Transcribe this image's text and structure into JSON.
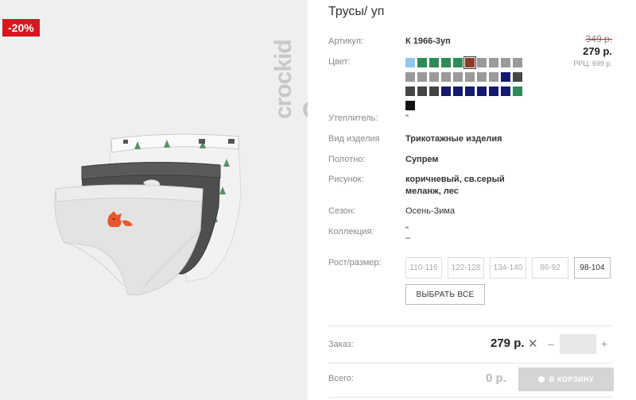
{
  "product": {
    "title": "Трусы/ уп",
    "discount_badge": "-20%",
    "brand_text": "crockid"
  },
  "price": {
    "old": "349 р.",
    "current": "279 р.",
    "rrp": "РРЦ: 699 р."
  },
  "attributes": {
    "article_label": "Артикул:",
    "article_value": "К 1966-3уп",
    "color_label": "Цвет:",
    "insulation_label": "Утеплитель:",
    "insulation_value": "\"",
    "kind_label": "Вид изделия",
    "kind_value": "Трикотажные изделия",
    "fabric_label": "Полотно:",
    "fabric_value": "Супрем",
    "pattern_label": "Рисунок:",
    "pattern_value_line1": "коричневый, св.серый",
    "pattern_value_line2": "меланж, лес",
    "season_label": "Сезон:",
    "season_value": "Осень-Зима",
    "collection_label": "Коллекция:",
    "collection_value_line1": "\"",
    "collection_value_line2": "–"
  },
  "swatches": [
    {
      "color": "#8ec7ef",
      "selected": false
    },
    {
      "color": "#2e8b57",
      "selected": false
    },
    {
      "color": "#2e8b57",
      "selected": false
    },
    {
      "color": "#2e8b57",
      "selected": false
    },
    {
      "color": "#2e8b57",
      "selected": false
    },
    {
      "color": "#8b3a2b",
      "selected": true
    },
    {
      "color": "#9a9a9a",
      "selected": false
    },
    {
      "color": "#9a9a9a",
      "selected": false
    },
    {
      "color": "#9a9a9a",
      "selected": false
    },
    {
      "color": "#9a9a9a",
      "selected": false
    },
    {
      "color": "#9a9a9a",
      "selected": false
    },
    {
      "color": "#9a9a9a",
      "selected": false
    },
    {
      "color": "#9a9a9a",
      "selected": false
    },
    {
      "color": "#9a9a9a",
      "selected": false
    },
    {
      "color": "#9a9a9a",
      "selected": false
    },
    {
      "color": "#9a9a9a",
      "selected": false
    },
    {
      "color": "#9a9a9a",
      "selected": false
    },
    {
      "color": "#9a9a9a",
      "selected": false
    },
    {
      "color": "#141a6e",
      "selected": false
    },
    {
      "color": "#444444",
      "selected": false
    },
    {
      "color": "#444444",
      "selected": false
    },
    {
      "color": "#444444",
      "selected": false
    },
    {
      "color": "#444444",
      "selected": false
    },
    {
      "color": "#141a6e",
      "selected": false
    },
    {
      "color": "#141a6e",
      "selected": false
    },
    {
      "color": "#141a6e",
      "selected": false
    },
    {
      "color": "#141a6e",
      "selected": false
    },
    {
      "color": "#141a6e",
      "selected": false
    },
    {
      "color": "#141a6e",
      "selected": false
    },
    {
      "color": "#2e8b57",
      "selected": false
    },
    {
      "color": "#111111",
      "selected": false
    }
  ],
  "sizes": {
    "label": "Рост/размер:",
    "options": [
      "110-116",
      "122-128",
      "134-140",
      "86-92",
      "98-104"
    ],
    "active_index": 4,
    "select_all": "ВЫБРАТЬ ВСЕ"
  },
  "order": {
    "label": "Заказ:",
    "price": "279 р.",
    "times": "✕",
    "minus": "–",
    "plus": "+",
    "quantity": ""
  },
  "total": {
    "label": "Всего:",
    "value": "0 р.",
    "cart_button": "В КОРЗИНУ"
  },
  "colors": {
    "accent": "#d9151e",
    "photo_bg": "#efefef",
    "cart_disabled": "#d5d5d5"
  },
  "icons": {
    "cart_icon": "cart-icon",
    "close_icon": "multiply-icon"
  }
}
